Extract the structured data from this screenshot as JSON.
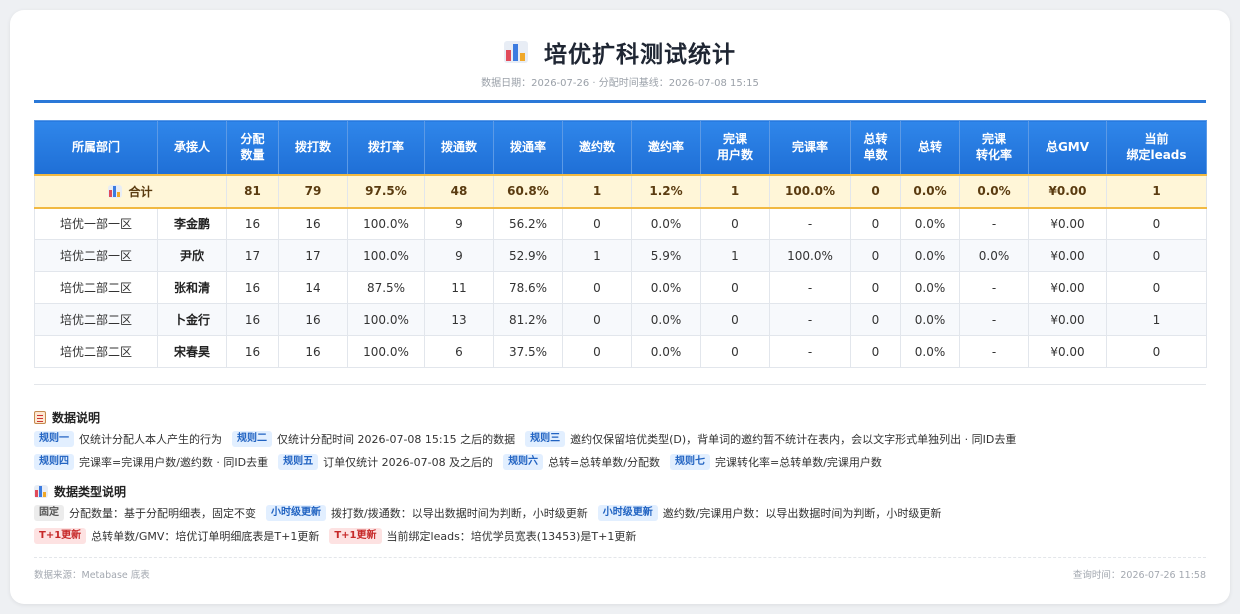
{
  "header": {
    "title": "培优扩科测试统计",
    "subtitle": "数据日期：2026-07-26 · 分配时间基线：2026-07-08 15:15"
  },
  "table": {
    "headers": [
      "所属部门",
      "承接人",
      "分配\n数量",
      "拨打数",
      "拨打率",
      "拨通数",
      "拨通率",
      "邀约数",
      "邀约率",
      "完课\n用户数",
      "完课率",
      "总转\n单数",
      "总转",
      "完课\n转化率",
      "总GMV",
      "当前\n绑定leads"
    ],
    "total": {
      "label": "合计",
      "values": [
        "81",
        "79",
        "97.5%",
        "48",
        "60.8%",
        "1",
        "1.2%",
        "1",
        "100.0%",
        "0",
        "0.0%",
        "0.0%",
        "¥0.00",
        "1"
      ]
    },
    "rows": [
      [
        "培优一部一区",
        "李金鹏",
        "16",
        "16",
        "100.0%",
        "9",
        "56.2%",
        "0",
        "0.0%",
        "0",
        "-",
        "0",
        "0.0%",
        "-",
        "¥0.00",
        "0"
      ],
      [
        "培优二部一区",
        "尹欣",
        "17",
        "17",
        "100.0%",
        "9",
        "52.9%",
        "1",
        "5.9%",
        "1",
        "100.0%",
        "0",
        "0.0%",
        "0.0%",
        "¥0.00",
        "0"
      ],
      [
        "培优二部二区",
        "张和清",
        "16",
        "14",
        "87.5%",
        "11",
        "78.6%",
        "0",
        "0.0%",
        "0",
        "-",
        "0",
        "0.0%",
        "-",
        "¥0.00",
        "0"
      ],
      [
        "培优二部二区",
        "卜金行",
        "16",
        "16",
        "100.0%",
        "13",
        "81.2%",
        "0",
        "0.0%",
        "0",
        "-",
        "0",
        "0.0%",
        "-",
        "¥0.00",
        "1"
      ],
      [
        "培优二部二区",
        "宋春昊",
        "16",
        "16",
        "100.0%",
        "6",
        "37.5%",
        "0",
        "0.0%",
        "0",
        "-",
        "0",
        "0.0%",
        "-",
        "¥0.00",
        "0"
      ]
    ]
  },
  "notes": {
    "title": "数据说明",
    "lines": [
      [
        {
          "tag": "规则一",
          "text": "仅统计分配人本人产生的行为"
        },
        {
          "tag": "规则二",
          "text": "仅统计分配时间 2026-07-08 15:15 之后的数据"
        },
        {
          "tag": "规则三",
          "text": "邀约仅保留培优类型(D)，背单词的邀约暂不统计在表内，会以文字形式单独列出 · 同ID去重"
        }
      ],
      [
        {
          "tag": "规则四",
          "text": "完课率=完课用户数/邀约数 · 同ID去重"
        },
        {
          "tag": "规则五",
          "text": "订单仅统计 2026-07-08 及之后的"
        },
        {
          "tag": "规则六",
          "text": "总转=总转单数/分配数"
        },
        {
          "tag": "规则七",
          "text": "完课转化率=总转单数/完课用户数"
        }
      ]
    ]
  },
  "types": {
    "title": "数据类型说明",
    "lines": [
      [
        {
          "tag": "固定",
          "kind": "gray",
          "text": "分配数量：基于分配明细表，固定不变"
        },
        {
          "tag": "小时级更新",
          "kind": "blue",
          "text": "拨打数/拨通数：以导出数据时间为判断，小时级更新"
        },
        {
          "tag": "小时级更新",
          "kind": "blue",
          "text": "邀约数/完课用户数：以导出数据时间为判断，小时级更新"
        }
      ],
      [
        {
          "tag": "T+1更新",
          "kind": "red",
          "text": "总转单数/GMV：培优订单明细底表是T+1更新"
        },
        {
          "tag": "T+1更新",
          "kind": "red",
          "text": "当前绑定leads：培优学员宽表(13453)是T+1更新"
        }
      ]
    ]
  },
  "footer": {
    "source": "数据来源：Metabase 底表",
    "query_time": "查询时间：2026-07-26 11:58"
  }
}
